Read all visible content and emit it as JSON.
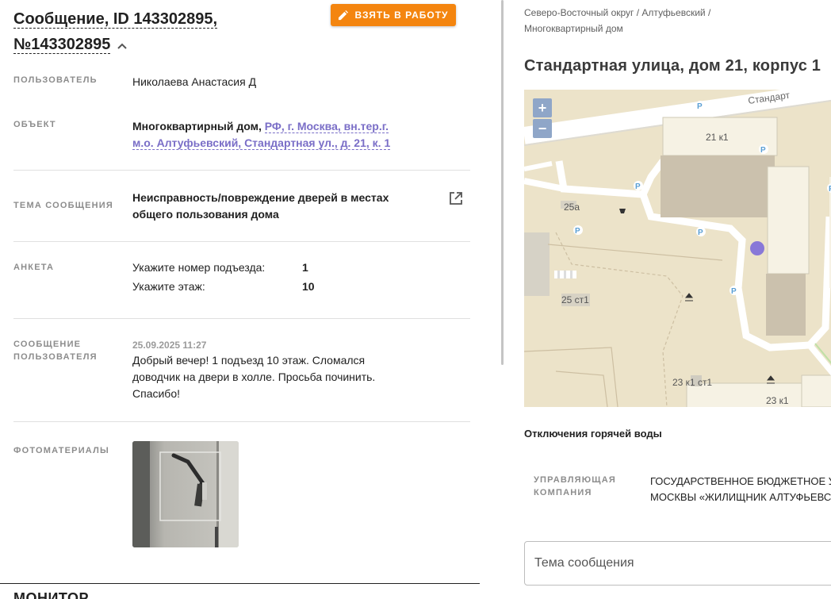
{
  "message": {
    "title": "Сообщение, ID 143302895, №143302895",
    "take_button": "ВЗЯТЬ В РАБОТУ"
  },
  "fields": {
    "user_label": "ПОЛЬЗОВАТЕЛЬ",
    "user_value": "Николаева Анастасия Д",
    "object_label": "ОБЪЕКТ",
    "object_type": "Многоквартирный дом,",
    "object_address": "РФ, г. Москва, вн.тер.г. м.о. Алтуфьевский, Стандартная ул., д. 21, к. 1",
    "topic_label": "ТЕМА СООБЩЕНИЯ",
    "topic_value": "Неисправность/повреждение дверей в местах общего пользования дома",
    "survey_label": "АНКЕТА",
    "survey": [
      {
        "question": "Укажите номер подъезда:",
        "answer": "1"
      },
      {
        "question": "Укажите этаж:",
        "answer": "10"
      }
    ],
    "user_message_label_1": "СООБЩЕНИЕ",
    "user_message_label_2": "ПОЛЬЗОВАТЕЛЯ",
    "user_message_date": "25.09.2025 11:27",
    "user_message_text": "Добрый вечер! 1 подъезд 10 этаж. Сломался доводчик на двери в холле. Просьба починить. Спасибо!",
    "photos_label": "ФОТОМАТЕРИАЛЫ"
  },
  "bottom_heading": "МОНИТОР",
  "right": {
    "breadcrumb": "Северо-Восточный округ / Алтуфьевский / Многоквартирный дом",
    "address": "Стандартная улица, дом 21, корпус 1",
    "map": {
      "zoom_in": "+",
      "zoom_out": "−",
      "street_label": "Стандарт",
      "labels": {
        "b21k1": "21 к1",
        "b25a": "25а",
        "b25st1": "25 ст1",
        "b23k1st1": "23 к1 ст1",
        "b23k1": "23 к1"
      },
      "parking_icon": "P"
    },
    "hot_water": "Отключения горячей воды",
    "management_label_1": "УПРАВЛЯЮЩАЯ",
    "management_label_2": "КОМПАНИЯ",
    "management_line_1": "ГОСУДАРСТВЕННОЕ БЮДЖЕТНОЕ У",
    "management_line_2": "МОСКВЫ «ЖИЛИЩНИК АЛТУФЬЕВС",
    "subject_placeholder": "Тема сообщения"
  },
  "colors": {
    "accent": "#f4850f",
    "link": "#7a6ec7",
    "marker": "#8878d8",
    "map_bg": "#ece3c9"
  }
}
